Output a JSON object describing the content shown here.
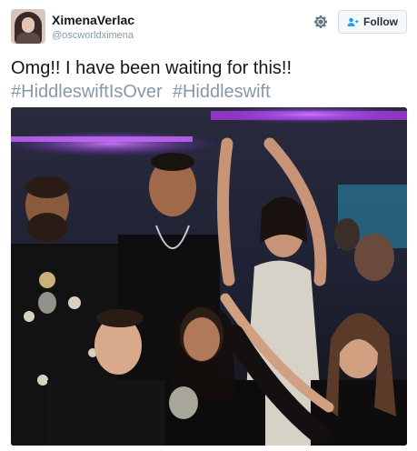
{
  "user": {
    "name": "XimenaVerlac",
    "handle": "@oscworldximena"
  },
  "actions": {
    "follow_label": "Follow",
    "settings_icon": "gear-icon",
    "follow_icon": "add-user-icon"
  },
  "tweet": {
    "text": "Omg!!  I have been waiting for this!!",
    "hashtags": [
      "#HiddleswiftIsOver",
      "#Hiddleswift"
    ]
  },
  "colors": {
    "text": "#14171a",
    "secondary": "#8899a6",
    "button_bg": "#f5f8fa",
    "button_border": "#d8dde1",
    "stage_light": "#b03be8"
  }
}
